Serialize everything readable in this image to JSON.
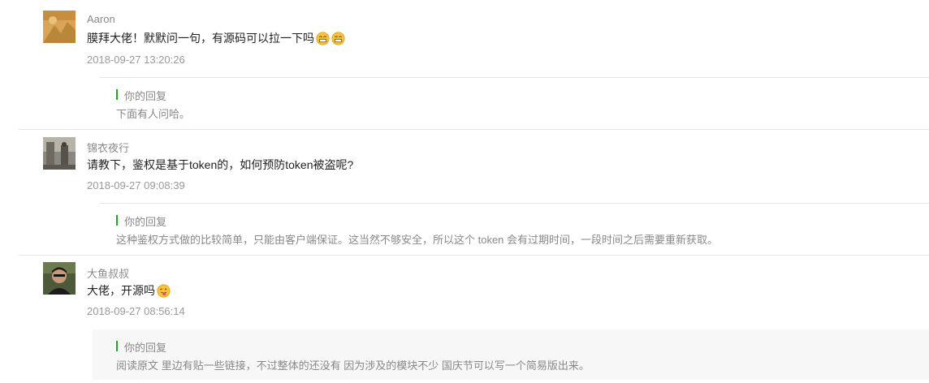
{
  "comments": [
    {
      "author": "Aaron",
      "text": "膜拜大佬！默默问一句，有源码可以拉一下吗",
      "emoji": "grin-emoji",
      "emoji_count": 2,
      "time": "2018-09-27 13:20:26",
      "reply_label": "你的回复",
      "reply_text": "下面有人问哈。"
    },
    {
      "author": "锦衣夜行",
      "text": "请教下，鉴权是基于token的，如何预防token被盗呢?",
      "time": "2018-09-27 09:08:39",
      "reply_label": "你的回复",
      "reply_text": "这种鉴权方式做的比较简单，只能由客户端保证。这当然不够安全，所以这个 token 会有过期时间，一段时间之后需要重新获取。"
    },
    {
      "author": "大鱼叔叔",
      "text": "大佬，开源吗",
      "emoji": "tongue-emoji",
      "emoji_count": 1,
      "time": "2018-09-27 08:56:14",
      "reply_label": "你的回复",
      "reply_text": "阅读原文 里边有贴一些链接，不过整体的还没有 因为涉及的模块不少 国庆节可以写一个简易版出来。"
    }
  ],
  "colors": {
    "accent": "#1aad19",
    "reply_background": "#f7f7f7",
    "divider": "#e5e5e5"
  }
}
